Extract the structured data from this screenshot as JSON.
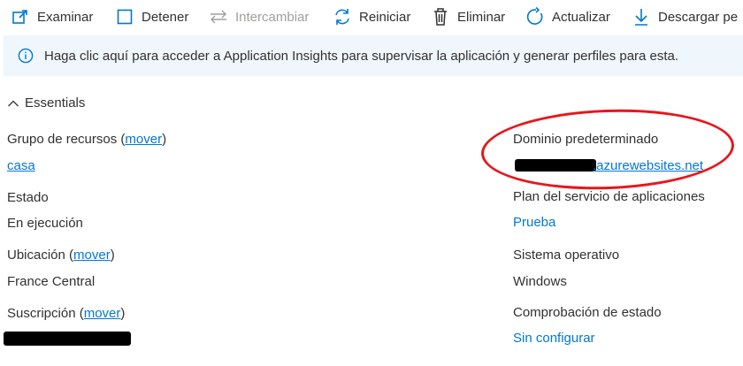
{
  "toolbar": {
    "examinar": "Examinar",
    "detener": "Detener",
    "intercambiar": "Intercambiar",
    "reiniciar": "Reiniciar",
    "eliminar": "Eliminar",
    "actualizar": "Actualizar",
    "descargar": "Descargar pe"
  },
  "banner": {
    "text": "Haga clic aquí para acceder a Application Insights para supervisar la aplicación y generar perfiles para esta."
  },
  "essentials": {
    "label": "Essentials"
  },
  "left": {
    "grupo_label": "Grupo de recursos",
    "grupo_open": " (",
    "grupo_move": "mover",
    "grupo_close": ")",
    "grupo_value": "casa",
    "estado_label": "Estado",
    "estado_value": "En ejecución",
    "ubicacion_label": "Ubicación",
    "ubicacion_open": " (",
    "ubicacion_move": "mover",
    "ubicacion_close": ")",
    "ubicacion_value": "France Central",
    "suscripcion_label": "Suscripción",
    "suscripcion_open": " (",
    "suscripcion_move": "mover",
    "suscripcion_close": ")"
  },
  "right": {
    "dominio_label": "Dominio predeterminado",
    "dominio_value": ".azurewebsites.net",
    "plan_label": "Plan del servicio de aplicaciones",
    "plan_value": "Prueba",
    "so_label": "Sistema operativo",
    "so_value": "Windows",
    "salud_label": "Comprobación de estado",
    "salud_value": "Sin configurar"
  },
  "colors": {
    "accent": "#0078d4",
    "banner_bg": "#eff6fc",
    "highlight": "#e8151c"
  }
}
